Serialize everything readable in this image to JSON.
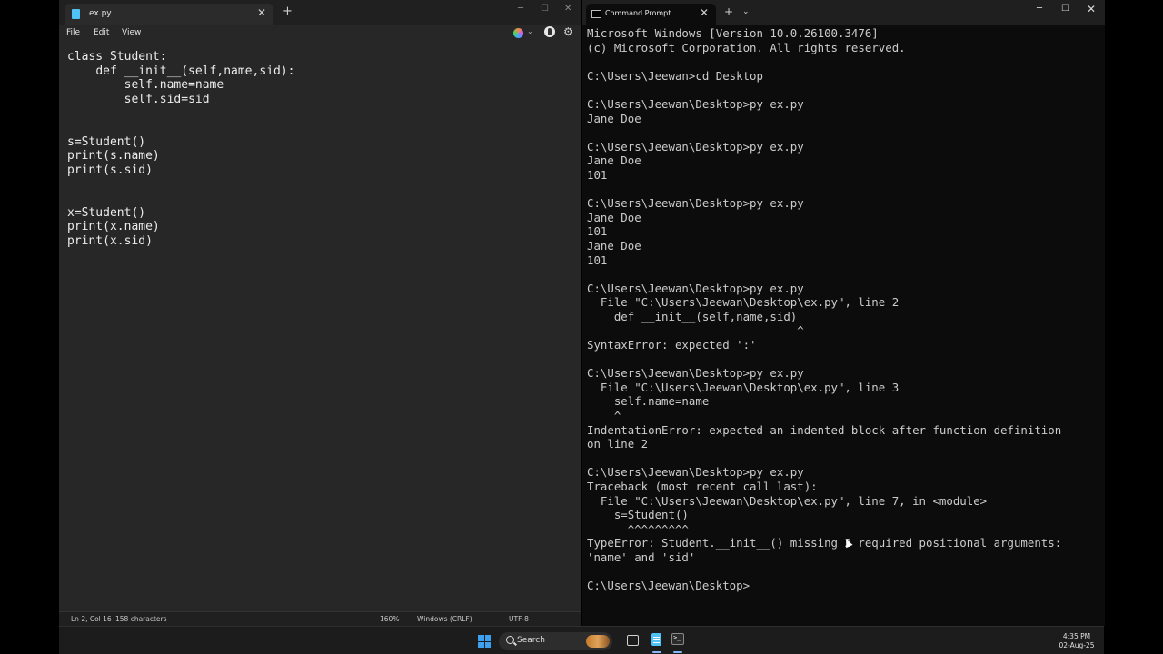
{
  "notepad": {
    "tab_title": "ex.py",
    "new_tab": "+",
    "menu": {
      "file": "File",
      "edit": "Edit",
      "view": "View"
    },
    "code": "class Student:\n\tdef __init__(self,name,sid):\n\t\tself.name=name\n\t\tself.sid=sid\n\n\ns=Student()\nprint(s.name)\nprint(s.sid)\n\n\nx=Student()\nprint(x.name)\nprint(x.sid)",
    "status": {
      "position": "Ln 2, Col 16",
      "characters": "158 characters",
      "zoom": "160%",
      "line_ending": "Windows (CRLF)",
      "encoding": "UTF-8"
    }
  },
  "cmd": {
    "tab_title": "Command Prompt",
    "new_tab": "+",
    "dropdown": "⌄",
    "output": "Microsoft Windows [Version 10.0.26100.3476]\n(c) Microsoft Corporation. All rights reserved.\n\nC:\\Users\\Jeewan>cd Desktop\n\nC:\\Users\\Jeewan\\Desktop>py ex.py\nJane Doe\n\nC:\\Users\\Jeewan\\Desktop>py ex.py\nJane Doe\n101\n\nC:\\Users\\Jeewan\\Desktop>py ex.py\nJane Doe\n101\nJane Doe\n101\n\nC:\\Users\\Jeewan\\Desktop>py ex.py\n  File \"C:\\Users\\Jeewan\\Desktop\\ex.py\", line 2\n    def __init__(self,name,sid)\n                               ^\nSyntaxError: expected ':'\n\nC:\\Users\\Jeewan\\Desktop>py ex.py\n  File \"C:\\Users\\Jeewan\\Desktop\\ex.py\", line 3\n    self.name=name\n    ^\nIndentationError: expected an indented block after function definition\non line 2\n\nC:\\Users\\Jeewan\\Desktop>py ex.py\nTraceback (most recent call last):\n  File \"C:\\Users\\Jeewan\\Desktop\\ex.py\", line 7, in <module>\n    s=Student()\n      ^^^^^^^^^\nTypeError: Student.__init__() missing 2 required positional arguments:\n'name' and 'sid'\n\nC:\\Users\\Jeewan\\Desktop>"
  },
  "taskbar": {
    "search_label": "Search",
    "time": "4:35 PM",
    "date": "02-Aug-25"
  },
  "icons": {
    "window_minimize": "─",
    "window_maximize": "☐",
    "window_close": "✕",
    "settings": "⚙",
    "chevron_down": "⌄"
  },
  "colors": {
    "notepad_bg": "#272727",
    "console_bg": "#0c0c0c",
    "console_text": "#cccccc",
    "accent": "#3ea1f0"
  }
}
